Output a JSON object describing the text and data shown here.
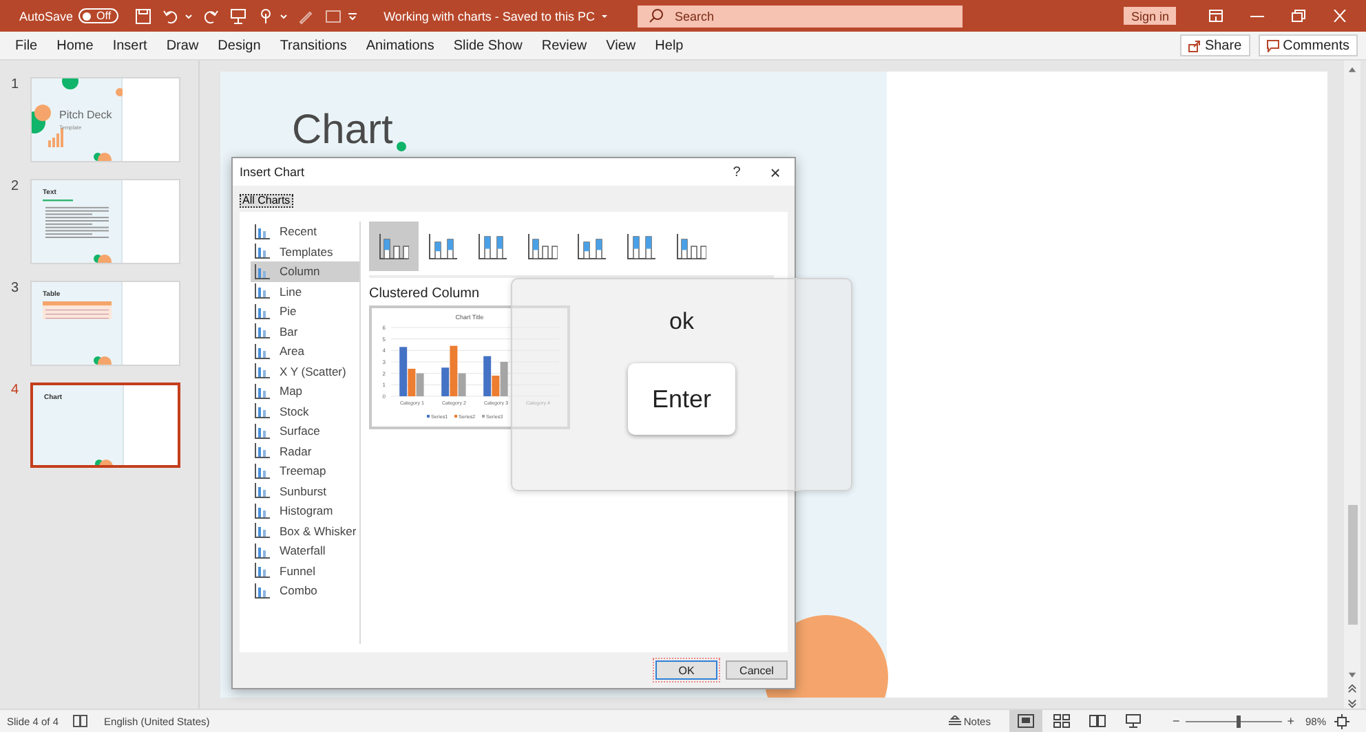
{
  "title_bar": {
    "autosave_label": "AutoSave",
    "autosave": {
      "label": "Off",
      "on": false
    },
    "document_title": "Working with charts - Saved to this PC",
    "search": {
      "placeholder": "Search"
    },
    "sign_in": "Sign in"
  },
  "menu": [
    "File",
    "Home",
    "Insert",
    "Draw",
    "Design",
    "Transitions",
    "Animations",
    "Slide Show",
    "Review",
    "View",
    "Help"
  ],
  "share": "Share",
  "comments": "Comments",
  "slides": [
    {
      "number": "1",
      "selected": false,
      "kind": "title",
      "title": "Pitch Deck",
      "subtitle": "Template"
    },
    {
      "number": "2",
      "selected": false,
      "kind": "text",
      "title": "Text"
    },
    {
      "number": "3",
      "selected": false,
      "kind": "table",
      "title": "Table"
    },
    {
      "number": "4",
      "selected": true,
      "kind": "chart",
      "title": "Chart"
    }
  ],
  "slide": {
    "title": "Chart"
  },
  "dialog": {
    "title": "Insert Chart",
    "help": "?",
    "close": "×",
    "tabs": [
      {
        "label": "All Charts",
        "selected": true
      }
    ],
    "chart_types": [
      {
        "label": "Recent",
        "selected": false
      },
      {
        "label": "Templates",
        "selected": false
      },
      {
        "label": "Column",
        "selected": true
      },
      {
        "label": "Line",
        "selected": false
      },
      {
        "label": "Pie",
        "selected": false
      },
      {
        "label": "Bar",
        "selected": false
      },
      {
        "label": "Area",
        "selected": false
      },
      {
        "label": "X Y (Scatter)",
        "selected": false
      },
      {
        "label": "Map",
        "selected": false
      },
      {
        "label": "Stock",
        "selected": false
      },
      {
        "label": "Surface",
        "selected": false
      },
      {
        "label": "Radar",
        "selected": false
      },
      {
        "label": "Treemap",
        "selected": false
      },
      {
        "label": "Sunburst",
        "selected": false
      },
      {
        "label": "Histogram",
        "selected": false
      },
      {
        "label": "Box & Whisker",
        "selected": false
      },
      {
        "label": "Waterfall",
        "selected": false
      },
      {
        "label": "Funnel",
        "selected": false
      },
      {
        "label": "Combo",
        "selected": false
      }
    ],
    "subtypes": [
      {
        "selected": true
      },
      {
        "selected": false
      },
      {
        "selected": false
      },
      {
        "selected": false
      },
      {
        "selected": false
      },
      {
        "selected": false
      },
      {
        "selected": false
      }
    ],
    "subtype_title": "Clustered Column",
    "preview": {
      "chart_data": {
        "type": "bar",
        "title": "Chart Title",
        "categories": [
          "Category 1",
          "Category 2",
          "Category 3",
          "Category 4"
        ],
        "series": [
          {
            "name": "Series1",
            "color": "#4472c4",
            "values": [
              4.3,
              2.5,
              3.5,
              null
            ]
          },
          {
            "name": "Series2",
            "color": "#ed7d31",
            "values": [
              2.4,
              4.4,
              1.8,
              null
            ]
          },
          {
            "name": "Series3",
            "color": "#a5a5a5",
            "values": [
              2,
              2,
              3,
              null
            ]
          }
        ],
        "ylim": [
          0,
          6
        ],
        "yticks": [
          0,
          1,
          2,
          3,
          4,
          5,
          6
        ],
        "grid": true,
        "legend": true
      }
    },
    "buttons": [
      {
        "label": "OK",
        "focused": true
      },
      {
        "label": "Cancel",
        "focused": false
      }
    ]
  },
  "overlay": {
    "text": "ok",
    "key": "Enter"
  },
  "status_bar": {
    "slide_info": "Slide 4 of 4",
    "language": "English (United States)",
    "notes": "Notes",
    "views": [
      {
        "selected": true
      },
      {
        "selected": false
      },
      {
        "selected": false
      },
      {
        "selected": false
      }
    ],
    "zoom": {
      "minus": "−",
      "plus": "+",
      "level": 0.55,
      "reading": "98%"
    }
  }
}
